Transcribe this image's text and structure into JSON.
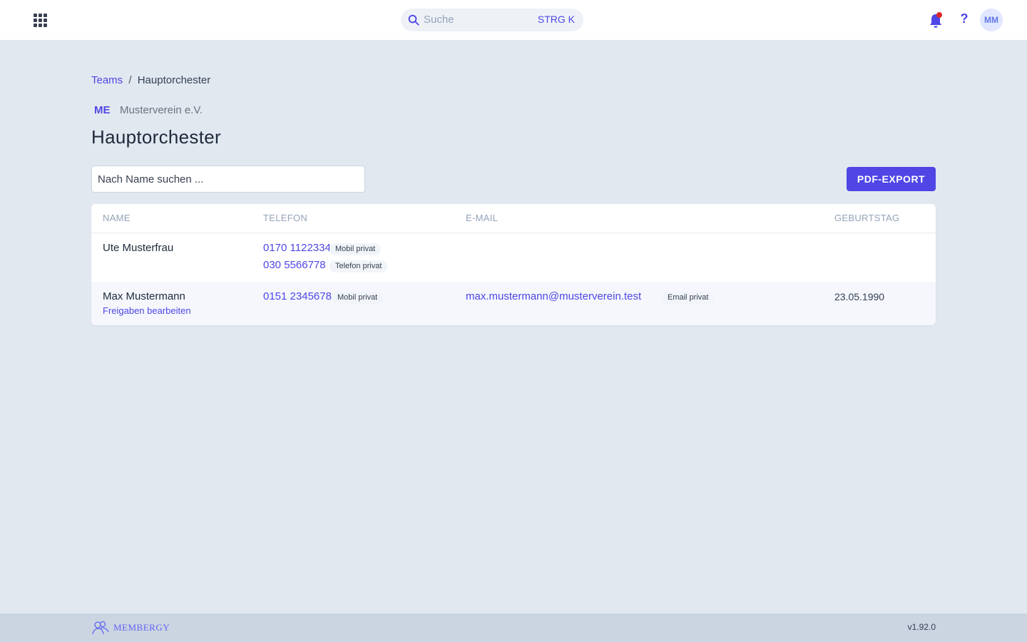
{
  "topbar": {
    "search_placeholder": "Suche",
    "search_shortcut": "STRG K",
    "avatar_initials": "MM",
    "help_label": "?",
    "notification_dot": true,
    "accent_color": "#4f46e5"
  },
  "breadcrumb": {
    "parent": "Teams",
    "separator": "/",
    "current": "Hauptorchester"
  },
  "org": {
    "abbr": "ME",
    "name": "Musterverein e.V."
  },
  "page": {
    "title": "Hauptorchester",
    "name_search_placeholder": "Nach Name suchen ...",
    "pdf_export_label": "PDF-EXPORT"
  },
  "table": {
    "headers": {
      "name": "NAME",
      "phone": "TELEFON",
      "email": "E-MAIL",
      "birthday": "GEBURTSTAG"
    },
    "rows": [
      {
        "name": "Ute Musterfrau",
        "phones": [
          {
            "number": "0170 1122334",
            "type": "Mobil privat"
          },
          {
            "number": "030 5566778",
            "type": "Telefon privat"
          }
        ],
        "email": "",
        "email_type": "",
        "birthday": "",
        "action": ""
      },
      {
        "name": "Max Mustermann",
        "phones": [
          {
            "number": "0151 2345678",
            "type": "Mobil privat"
          }
        ],
        "email": "max.mustermann@musterverein.test",
        "email_type": "Email privat",
        "birthday": "23.05.1990",
        "action": "Freigaben bearbeiten"
      }
    ]
  },
  "footer": {
    "brand": "MEMBERGY",
    "version": "v1.92.0"
  },
  "icons": {
    "apps": "apps-grid-icon",
    "search": "search-icon",
    "bell": "bell-icon",
    "logo": "membergy-logo-icon"
  }
}
